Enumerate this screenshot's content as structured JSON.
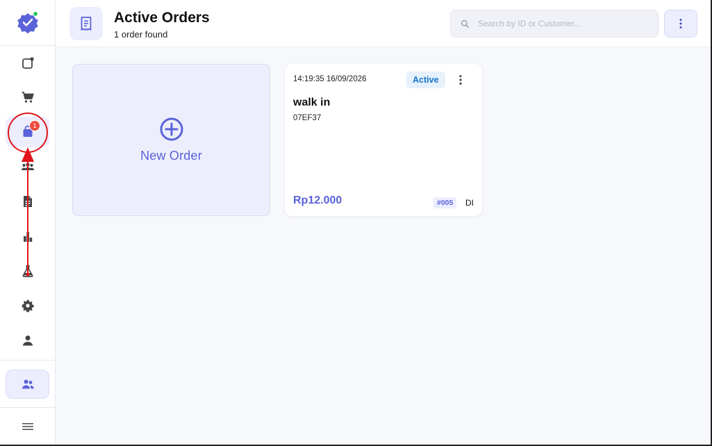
{
  "header": {
    "title": "Active Orders",
    "subtitle": "1 order found",
    "search_placeholder": "Search by ID or Customer..."
  },
  "sidebar": {
    "items": [
      {
        "icon": "new-tab-icon",
        "active": false
      },
      {
        "icon": "cart-icon",
        "active": false
      },
      {
        "icon": "shopping-bag-icon",
        "active": true,
        "badge": "1"
      },
      {
        "icon": "users-icon",
        "active": false
      },
      {
        "icon": "document-icon",
        "active": false
      },
      {
        "icon": "bar-chart-icon",
        "active": false
      },
      {
        "icon": "flask-icon",
        "active": false
      },
      {
        "icon": "gear-icon",
        "active": false
      },
      {
        "icon": "person-icon",
        "active": false
      }
    ],
    "bottom_icon": "staff-icon",
    "menu_icon": "hamburger-icon"
  },
  "new_order": {
    "label": "New Order"
  },
  "orders": [
    {
      "time": "14:19:35 16/09/2026",
      "status": "Active",
      "customer": "walk in",
      "code": "07EF37",
      "price": "Rp12.000",
      "number": "#005",
      "type": "DI"
    }
  ],
  "colors": {
    "accent": "#5a63d8",
    "status_text": "#1673c9",
    "badge": "#ef4b3f",
    "annotation": "#e0141a"
  }
}
